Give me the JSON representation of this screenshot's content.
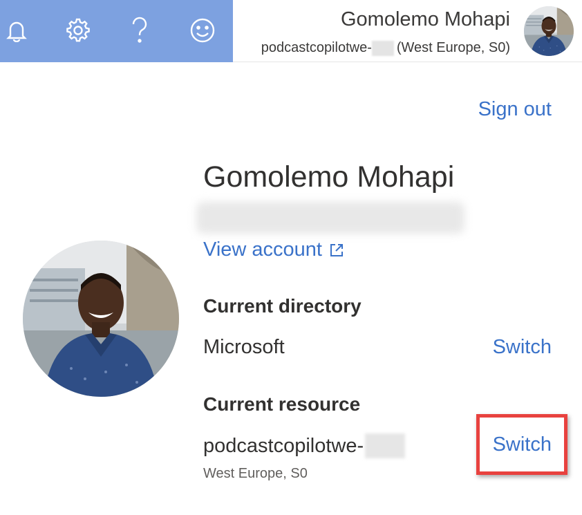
{
  "topbar": {
    "icons": [
      "bell-icon",
      "gear-icon",
      "help-icon",
      "smiley-icon"
    ],
    "accent_color": "#7da1e0",
    "account_name": "Gomolemo Mohapi",
    "resource_prefix": "podcastcopilotwe-",
    "resource_region": "(West Europe, S0)"
  },
  "panel": {
    "sign_out": "Sign out",
    "user_name": "Gomolemo Mohapi",
    "view_account": "View account",
    "directory_label": "Current directory",
    "directory_value": "Microsoft",
    "directory_switch": "Switch",
    "resource_label": "Current resource",
    "resource_value": "podcastcopilotwe-",
    "resource_switch": "Switch",
    "resource_sub": "West Europe, S0",
    "link_color": "#3a72c9",
    "highlight_color": "#e8423f"
  }
}
